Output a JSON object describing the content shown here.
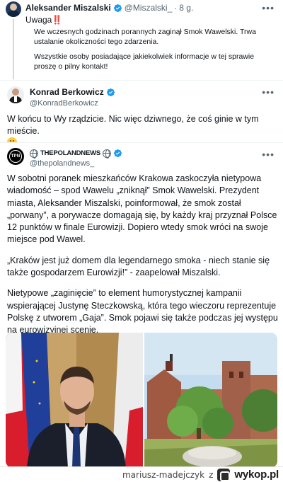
{
  "tweet1": {
    "author_name": "Aleksander Miszalski",
    "handle": "@Miszalski_",
    "separator": "·",
    "time": "8 g.",
    "text": "Uwaga",
    "text_emoji": "‼️",
    "card_paragraph1": "We wczesnych godzinach porannych zaginął Smok Wawelski. Trwa ustalanie okoliczności tego zdarzenia.",
    "card_paragraph2": "Wszystkie osoby posiadające jakiekolwiek informacje w tej sprawie proszę o pilny kontakt!"
  },
  "tweet2": {
    "author_name": "Konrad Berkowicz",
    "handle": "@KonradBerkowicz",
    "text": "W końcu to Wy rządzicie. Nic więc dziwnego, że coś ginie w tym mieście."
  },
  "tweet3": {
    "author_name": "THEPOLANDNEWS",
    "avatar_text": "TPN",
    "handle": "@thepolandnews_",
    "paragraph1": "W sobotni poranek mieszkańców Krakowa zaskoczyła nietypowa wiadomość – spod Wawelu „zniknął” Smok Wawelski. Prezydent miasta, Aleksander Miszalski, poinformował, że smok został „porwany”, a porywacze domagają się, by każdy kraj przyznał Polsce 12 punktów w finale Eurowizji. Dopiero wtedy smok wróci na swoje miejsce pod Wawel.",
    "paragraph2": "„Kraków jest już domem dla legendarnego smoka - niech stanie się także gospodarzem Eurowizji!” - zaapelował Miszalski.",
    "paragraph3": "Nietypowe „zaginięcie” to element humorystycznej kampanii wspierającej Justynę Steczkowską, która tego wieczoru reprezentuje Polskę z utworem „Gaja”. Smok pojawi się także podczas jej występu na eurowizyjnej scenie."
  },
  "footer": {
    "source_user": "mariusz-madejczyk",
    "source_sep": "z",
    "site": "wykop.pl"
  },
  "colors": {
    "verified": "#1d9bf0",
    "text": "#0f1419",
    "secondary": "#536471"
  },
  "icons": {
    "verified": "verified-badge-icon",
    "more": "more-horizontal-icon",
    "globe": "globe-icon",
    "smile": "smiling-face-emoji"
  }
}
